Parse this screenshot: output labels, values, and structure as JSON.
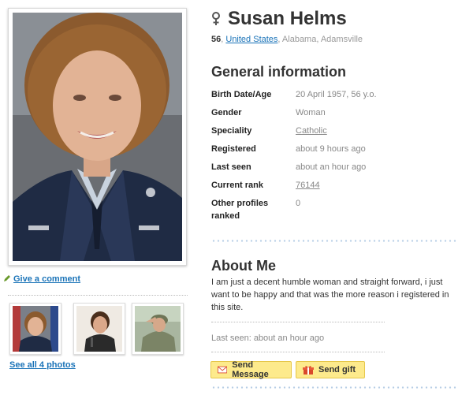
{
  "profile": {
    "name": "Susan Helms",
    "gender_icon": "female-symbol-icon",
    "age": "56",
    "country": "United States",
    "location_rest": ", Alabama, Adamsville"
  },
  "left": {
    "give_comment": "Give a comment",
    "see_all_photos": "See all 4 photos"
  },
  "general": {
    "title": "General information",
    "rows": [
      {
        "label": "Birth Date/Age",
        "value": "20 April 1957, 56 y.o."
      },
      {
        "label": "Gender",
        "value": "Woman"
      },
      {
        "label": "Speciality",
        "value": "Catholic"
      },
      {
        "label": "Registered",
        "value": "about 9 hours ago"
      },
      {
        "label": "Last seen",
        "value": "about an hour ago"
      },
      {
        "label": "Current rank",
        "value": "76144"
      },
      {
        "label": "Other profiles ranked",
        "value": "0"
      }
    ]
  },
  "about": {
    "title": "About Me",
    "text": "I am just a decent humble woman and straight forward, i just want to be happy and that was the more reason i registered in this site.",
    "last_seen": "Last seen: about an hour ago"
  },
  "actions": {
    "send_message": "Send Message",
    "send_gift": "Send gift"
  },
  "colors": {
    "link": "#1a73b8",
    "button_bg": "#fdea8c",
    "button_border": "#e6c74a"
  }
}
